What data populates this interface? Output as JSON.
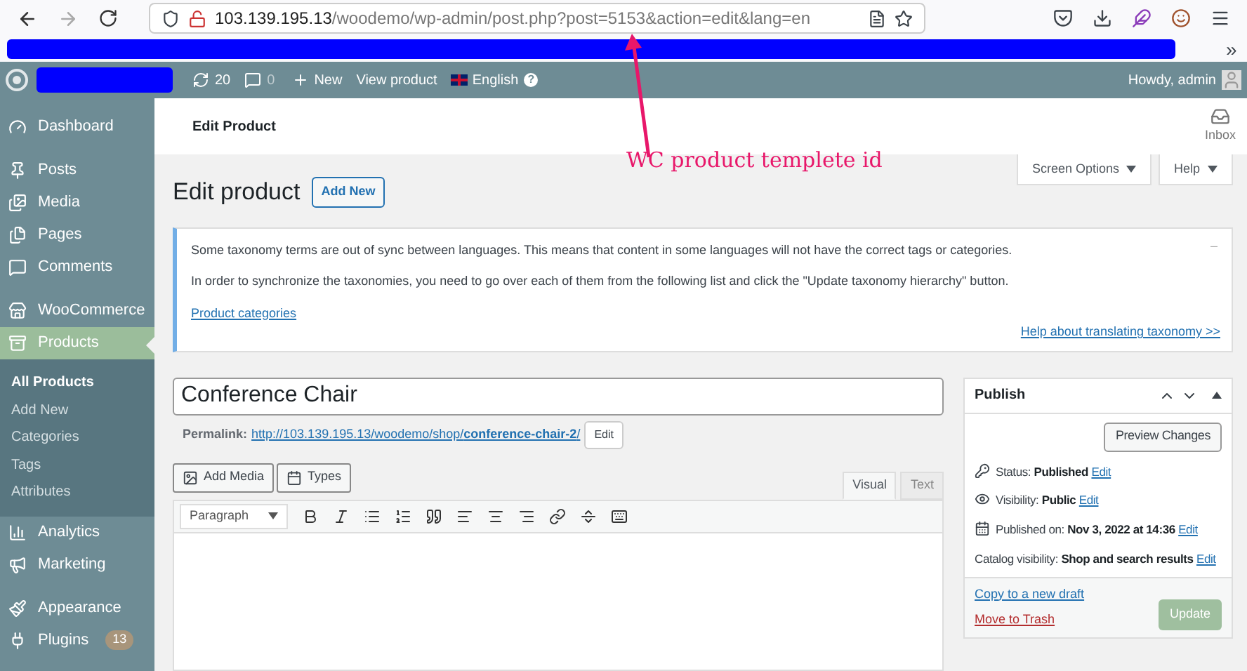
{
  "browser": {
    "url_host": "103.139.195.13",
    "url_path": "/woodemo/wp-admin/post.php?post=5153&action=edit&lang=en",
    "overflow": "»"
  },
  "admin_bar": {
    "updates": "20",
    "comments": "0",
    "new": "New",
    "view": "View product",
    "language": "English",
    "help": "?",
    "greeting": "Howdy, admin"
  },
  "sidebar": {
    "items": [
      {
        "label": "Dashboard",
        "selected": false
      },
      {
        "label": "Posts",
        "selected": false
      },
      {
        "label": "Media",
        "selected": false
      },
      {
        "label": "Pages",
        "selected": false
      },
      {
        "label": "Comments",
        "selected": false
      },
      {
        "label": "WooCommerce",
        "selected": false
      },
      {
        "label": "Products",
        "selected": true
      },
      {
        "label": "Analytics",
        "selected": false
      },
      {
        "label": "Marketing",
        "selected": false
      },
      {
        "label": "Appearance",
        "selected": false
      },
      {
        "label": "Plugins",
        "selected": false,
        "badge": "13"
      }
    ],
    "submenu": [
      {
        "label": "All Products",
        "selected": true
      },
      {
        "label": "Add New",
        "selected": false
      },
      {
        "label": "Categories",
        "selected": false
      },
      {
        "label": "Tags",
        "selected": false
      },
      {
        "label": "Attributes",
        "selected": false
      }
    ]
  },
  "header": {
    "title": "Edit Product",
    "inbox": "Inbox"
  },
  "screen_options": "Screen Options",
  "help": "Help",
  "page_title": "Edit product",
  "add_new": "Add New",
  "notice": {
    "lines": [
      "Some taxonomy terms are out of sync between languages. This means that content in some languages will not have the correct tags or categories.",
      "In order to synchronize the taxonomies, you need to go over each of them from the following list and click the \"Update taxonomy hierarchy\" button."
    ],
    "link": "Product categories",
    "dismiss": "–",
    "help_link": "Help about translating taxonomy >>"
  },
  "title_field": {
    "value": "Conference Chair"
  },
  "permalink": {
    "label": "Permalink:",
    "url_base": "http://103.139.195.13/woodemo/shop/",
    "slug": "conference-chair-2",
    "url_end": "/",
    "edit": "Edit"
  },
  "media_buttons": [
    "Add Media",
    "Types"
  ],
  "editor_tabs": [
    {
      "label": "Visual",
      "selected": true
    },
    {
      "label": "Text",
      "selected": false
    }
  ],
  "format_select": "Paragraph",
  "publish": {
    "title": "Publish",
    "preview": "Preview Changes",
    "rows": [
      {
        "label": "Status:",
        "value": "Published",
        "edit": "Edit"
      },
      {
        "label": "Visibility:",
        "value": "Public",
        "edit": "Edit"
      },
      {
        "label": "Published on:",
        "value": "Nov 3, 2022 at 14:36",
        "edit": "Edit"
      },
      {
        "label": "Catalog visibility:",
        "value": "Shop and search results",
        "edit": "Edit"
      }
    ],
    "copy": "Copy to a new draft",
    "trash": "Move to Trash",
    "update": "Update",
    "update_disabled": true
  },
  "annotation": "WC product templete id"
}
